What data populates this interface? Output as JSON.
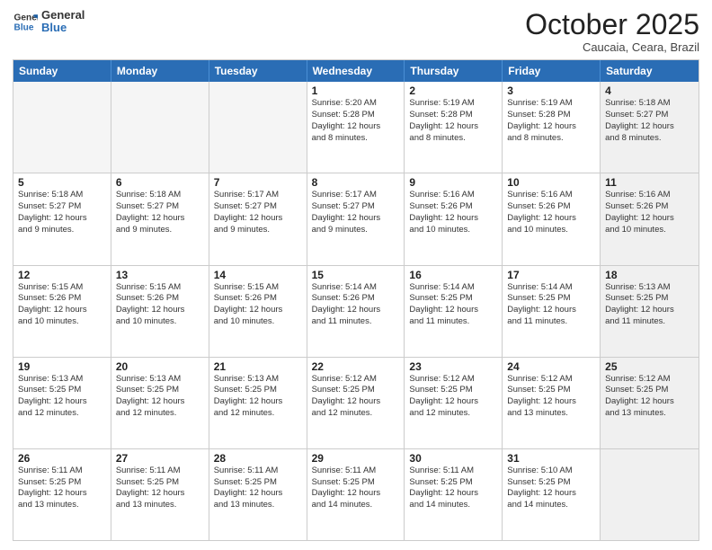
{
  "header": {
    "logo_line1": "General",
    "logo_line2": "Blue",
    "month": "October 2025",
    "location": "Caucaia, Ceara, Brazil"
  },
  "weekdays": [
    "Sunday",
    "Monday",
    "Tuesday",
    "Wednesday",
    "Thursday",
    "Friday",
    "Saturday"
  ],
  "rows": [
    [
      {
        "day": "",
        "text": "",
        "empty": true
      },
      {
        "day": "",
        "text": "",
        "empty": true
      },
      {
        "day": "",
        "text": "",
        "empty": true
      },
      {
        "day": "1",
        "text": "Sunrise: 5:20 AM\nSunset: 5:28 PM\nDaylight: 12 hours\nand 8 minutes."
      },
      {
        "day": "2",
        "text": "Sunrise: 5:19 AM\nSunset: 5:28 PM\nDaylight: 12 hours\nand 8 minutes."
      },
      {
        "day": "3",
        "text": "Sunrise: 5:19 AM\nSunset: 5:28 PM\nDaylight: 12 hours\nand 8 minutes."
      },
      {
        "day": "4",
        "text": "Sunrise: 5:18 AM\nSunset: 5:27 PM\nDaylight: 12 hours\nand 8 minutes.",
        "shaded": true
      }
    ],
    [
      {
        "day": "5",
        "text": "Sunrise: 5:18 AM\nSunset: 5:27 PM\nDaylight: 12 hours\nand 9 minutes."
      },
      {
        "day": "6",
        "text": "Sunrise: 5:18 AM\nSunset: 5:27 PM\nDaylight: 12 hours\nand 9 minutes."
      },
      {
        "day": "7",
        "text": "Sunrise: 5:17 AM\nSunset: 5:27 PM\nDaylight: 12 hours\nand 9 minutes."
      },
      {
        "day": "8",
        "text": "Sunrise: 5:17 AM\nSunset: 5:27 PM\nDaylight: 12 hours\nand 9 minutes."
      },
      {
        "day": "9",
        "text": "Sunrise: 5:16 AM\nSunset: 5:26 PM\nDaylight: 12 hours\nand 10 minutes."
      },
      {
        "day": "10",
        "text": "Sunrise: 5:16 AM\nSunset: 5:26 PM\nDaylight: 12 hours\nand 10 minutes."
      },
      {
        "day": "11",
        "text": "Sunrise: 5:16 AM\nSunset: 5:26 PM\nDaylight: 12 hours\nand 10 minutes.",
        "shaded": true
      }
    ],
    [
      {
        "day": "12",
        "text": "Sunrise: 5:15 AM\nSunset: 5:26 PM\nDaylight: 12 hours\nand 10 minutes."
      },
      {
        "day": "13",
        "text": "Sunrise: 5:15 AM\nSunset: 5:26 PM\nDaylight: 12 hours\nand 10 minutes."
      },
      {
        "day": "14",
        "text": "Sunrise: 5:15 AM\nSunset: 5:26 PM\nDaylight: 12 hours\nand 10 minutes."
      },
      {
        "day": "15",
        "text": "Sunrise: 5:14 AM\nSunset: 5:26 PM\nDaylight: 12 hours\nand 11 minutes."
      },
      {
        "day": "16",
        "text": "Sunrise: 5:14 AM\nSunset: 5:25 PM\nDaylight: 12 hours\nand 11 minutes."
      },
      {
        "day": "17",
        "text": "Sunrise: 5:14 AM\nSunset: 5:25 PM\nDaylight: 12 hours\nand 11 minutes."
      },
      {
        "day": "18",
        "text": "Sunrise: 5:13 AM\nSunset: 5:25 PM\nDaylight: 12 hours\nand 11 minutes.",
        "shaded": true
      }
    ],
    [
      {
        "day": "19",
        "text": "Sunrise: 5:13 AM\nSunset: 5:25 PM\nDaylight: 12 hours\nand 12 minutes."
      },
      {
        "day": "20",
        "text": "Sunrise: 5:13 AM\nSunset: 5:25 PM\nDaylight: 12 hours\nand 12 minutes."
      },
      {
        "day": "21",
        "text": "Sunrise: 5:13 AM\nSunset: 5:25 PM\nDaylight: 12 hours\nand 12 minutes."
      },
      {
        "day": "22",
        "text": "Sunrise: 5:12 AM\nSunset: 5:25 PM\nDaylight: 12 hours\nand 12 minutes."
      },
      {
        "day": "23",
        "text": "Sunrise: 5:12 AM\nSunset: 5:25 PM\nDaylight: 12 hours\nand 12 minutes."
      },
      {
        "day": "24",
        "text": "Sunrise: 5:12 AM\nSunset: 5:25 PM\nDaylight: 12 hours\nand 13 minutes."
      },
      {
        "day": "25",
        "text": "Sunrise: 5:12 AM\nSunset: 5:25 PM\nDaylight: 12 hours\nand 13 minutes.",
        "shaded": true
      }
    ],
    [
      {
        "day": "26",
        "text": "Sunrise: 5:11 AM\nSunset: 5:25 PM\nDaylight: 12 hours\nand 13 minutes."
      },
      {
        "day": "27",
        "text": "Sunrise: 5:11 AM\nSunset: 5:25 PM\nDaylight: 12 hours\nand 13 minutes."
      },
      {
        "day": "28",
        "text": "Sunrise: 5:11 AM\nSunset: 5:25 PM\nDaylight: 12 hours\nand 13 minutes."
      },
      {
        "day": "29",
        "text": "Sunrise: 5:11 AM\nSunset: 5:25 PM\nDaylight: 12 hours\nand 14 minutes."
      },
      {
        "day": "30",
        "text": "Sunrise: 5:11 AM\nSunset: 5:25 PM\nDaylight: 12 hours\nand 14 minutes."
      },
      {
        "day": "31",
        "text": "Sunrise: 5:10 AM\nSunset: 5:25 PM\nDaylight: 12 hours\nand 14 minutes."
      },
      {
        "day": "",
        "text": "",
        "empty": true,
        "shaded": true
      }
    ]
  ]
}
